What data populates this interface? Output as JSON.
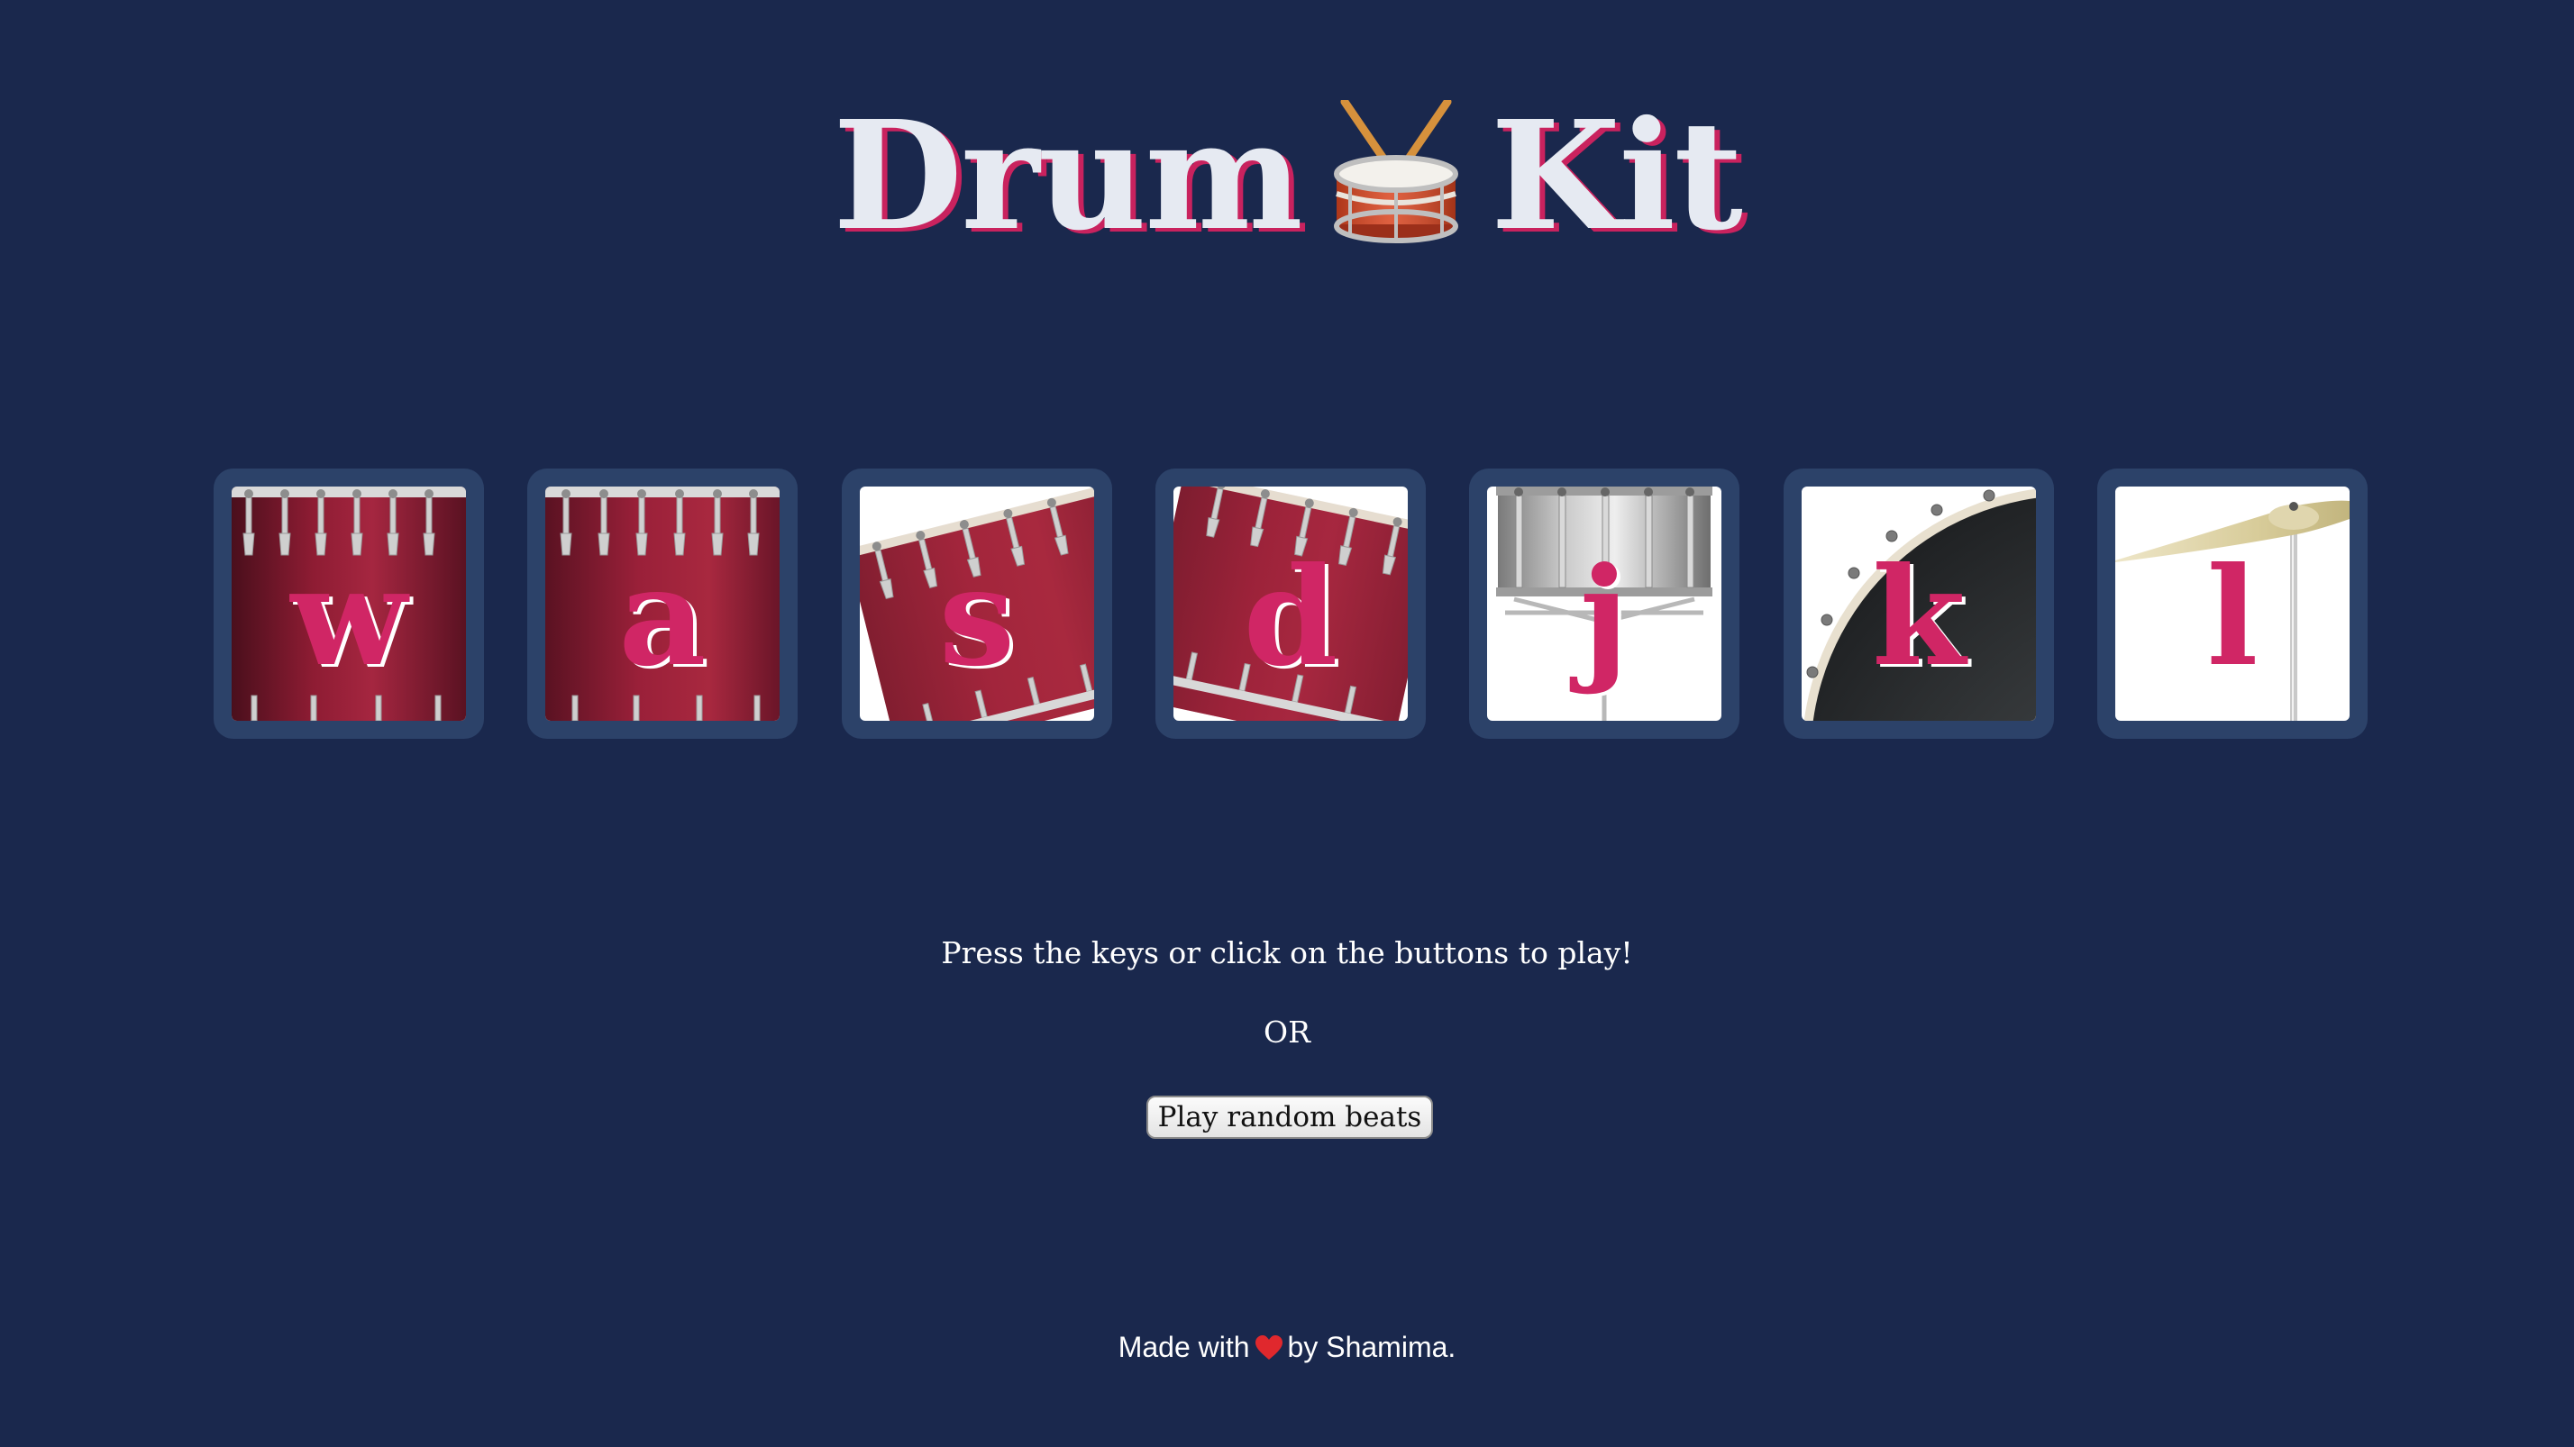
{
  "header": {
    "title_left": "Drum",
    "title_right": "Kit",
    "title_icon": "drum-emoji-icon"
  },
  "drums": [
    {
      "key": "w",
      "icon": "tom-drum-icon"
    },
    {
      "key": "a",
      "icon": "tom-drum-icon"
    },
    {
      "key": "s",
      "icon": "tilted-tom-drum-icon"
    },
    {
      "key": "d",
      "icon": "tilted-tom-drum-icon"
    },
    {
      "key": "j",
      "icon": "snare-drum-icon"
    },
    {
      "key": "k",
      "icon": "kick-drum-icon"
    },
    {
      "key": "l",
      "icon": "cymbal-icon"
    }
  ],
  "instructions": {
    "text": "Press the keys or click on the buttons to play!",
    "or_text": "OR",
    "random_button_label": "Play random beats"
  },
  "footer": {
    "made_with": "Made with",
    "by_text": "by Shamima.",
    "heart_icon": "heart-icon"
  },
  "colors": {
    "background": "#1a284d",
    "drum_frame": "#2c4269",
    "accent_pink": "#d02665",
    "title_text": "#e6eaf2"
  }
}
